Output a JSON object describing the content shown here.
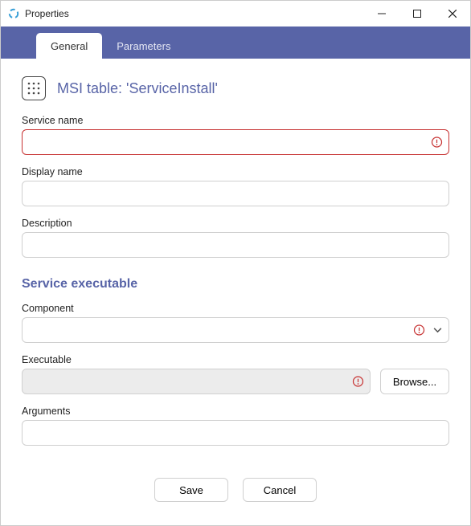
{
  "window": {
    "title": "Properties"
  },
  "tabs": {
    "general": "General",
    "parameters": "Parameters",
    "active": "general"
  },
  "header": {
    "title": "MSI table: 'ServiceInstall'"
  },
  "fields": {
    "service_name": {
      "label": "Service name",
      "value": "",
      "error": true
    },
    "display_name": {
      "label": "Display name",
      "value": ""
    },
    "description": {
      "label": "Description",
      "value": ""
    }
  },
  "section_executable": {
    "title": "Service executable",
    "component": {
      "label": "Component",
      "value": "",
      "error": true
    },
    "executable": {
      "label": "Executable",
      "value": "",
      "error": true
    },
    "arguments": {
      "label": "Arguments",
      "value": ""
    },
    "browse_label": "Browse..."
  },
  "buttons": {
    "save": "Save",
    "cancel": "Cancel"
  }
}
